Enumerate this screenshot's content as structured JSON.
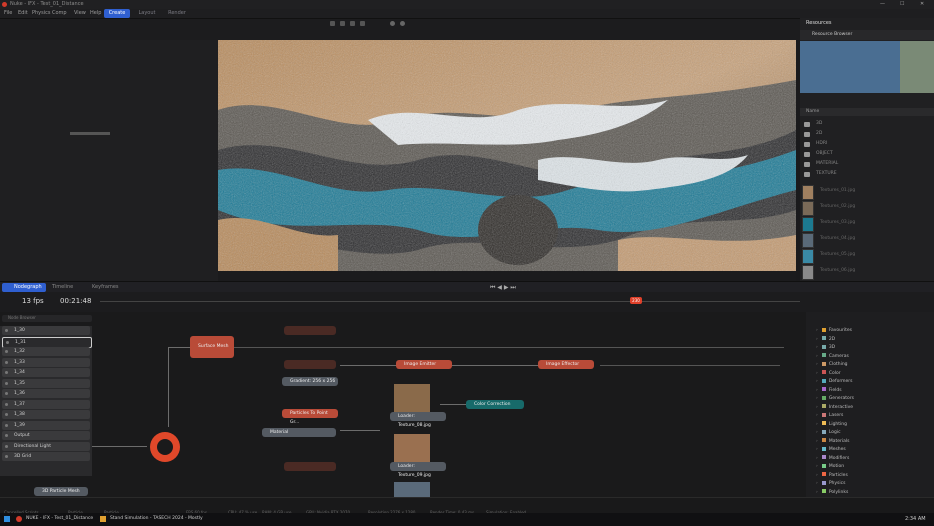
{
  "window": {
    "title": "Nuke - IFX - Test_01_Distance"
  },
  "menus": [
    "File",
    "Edit",
    "Physics",
    "Comp",
    "View",
    "Help"
  ],
  "tabs": [
    {
      "label": "Create",
      "active": true
    },
    {
      "label": "Layout",
      "active": false
    },
    {
      "label": "Render",
      "active": false
    }
  ],
  "resources": {
    "tab_label": "Resources",
    "header": "Resource Browser",
    "column_name": "Name",
    "folders": [
      "3D",
      "2D",
      "HDRI",
      "OBJECT",
      "MATERIAL",
      "TEXTURE"
    ],
    "files": [
      "Textures_01.jpg",
      "Textures_02.jpg",
      "Textures_03.jpg",
      "Textures_04.jpg",
      "Textures_05.jpg",
      "Textures_06.jpg"
    ]
  },
  "nodegraph": {
    "tab_label": "Nodegraph",
    "tab2_label": "Timeline",
    "tab3_label": "Keyframes",
    "search_placeholder": "Node Browser"
  },
  "timeline": {
    "fps": "13 fps",
    "timecode": "00:21:48",
    "frame": "230"
  },
  "tool_list": [
    "1_30",
    "1_31",
    "1_32",
    "1_33",
    "1_34",
    "1_35",
    "1_36",
    "1_37",
    "1_38",
    "1_39",
    "Output",
    "Directional Light",
    "3D Grid"
  ],
  "nodes": {
    "surface": "Surface Mesh",
    "image_emitter": "Image Emitter",
    "image_effector": "Image Effector",
    "gradient": "Gradient: 256 x 256",
    "particle_to_point": "Particles To Point Gr...",
    "material": "Material",
    "loader1": "Loader: Texture_08.jpg",
    "loader2": "Loader: Texture_09.jpg",
    "color_correction": "Color Correction",
    "particle_mesh": "3D Particle Mesh"
  },
  "library": [
    "Favourites",
    "2D",
    "3D",
    "Cameras",
    "Clothing",
    "Color",
    "Deformers",
    "Fields",
    "Generators",
    "Interactive",
    "Lasers",
    "Lighting",
    "Logic",
    "Materials",
    "Meshes",
    "Modifiers",
    "Motion",
    "Particles",
    "Physics",
    "Polylinks"
  ],
  "library_colors": [
    "#e0a030",
    "#7aa",
    "#7aa",
    "#6a8",
    "#c96",
    "#c55",
    "#5ab",
    "#a6c",
    "#6a6",
    "#aa6",
    "#c77",
    "#eb5",
    "#8ab",
    "#c84",
    "#6bc",
    "#a8c",
    "#7c8",
    "#e64",
    "#99c",
    "#8c6"
  ],
  "status": [
    "Cancelled Scripts",
    "Particle",
    "Particle",
    "FPS 60 fps",
    "CPU: 47 % use",
    "RAM: 4 GB use",
    "GPU: Nvidia RTX 2070",
    "Resolution 2276 x 1280",
    "Render Time: 0.43 ms",
    "Simulation: Enabled"
  ],
  "taskbar": {
    "app1": "NUKE - IFX - Test_01_Distance",
    "app2": "Stand Simulation - TASECH 2024 - Mostly",
    "time": "2:34 AM"
  }
}
